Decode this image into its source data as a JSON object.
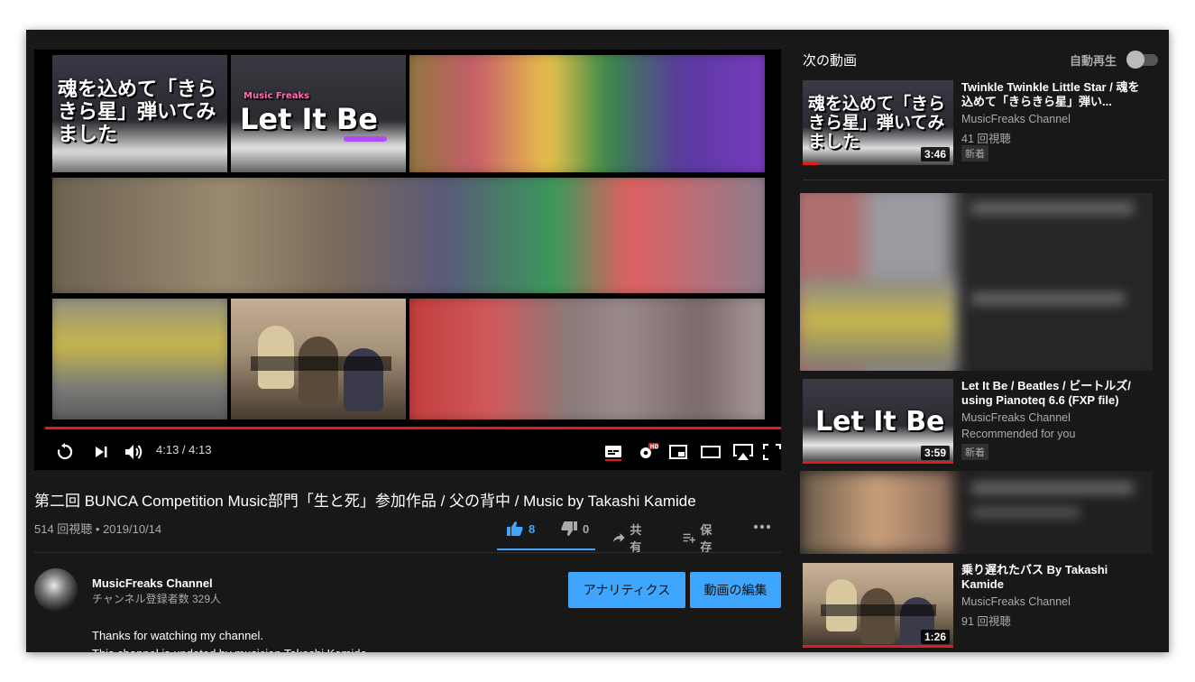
{
  "player": {
    "time": "4:13 / 4:13",
    "endscreen": {
      "tile1_text": "魂を込めて「きらきら星」弾いてみました",
      "tile2_text": "Let It Be",
      "tile2_sub": "Music Freaks"
    }
  },
  "video": {
    "title": "第二回 BUNCA Competition Music部門「生と死」参加作品 / 父の背中 / Music by Takashi Kamide",
    "meta": "514 回視聴 • 2019/10/14",
    "likes": "8",
    "dislikes": "0",
    "share_label": "共有",
    "save_label": "保存"
  },
  "channel": {
    "name": "MusicFreaks Channel",
    "subscribers": "チャンネル登録者数 329人",
    "analytics_button": "アナリティクス",
    "edit_button": "動画の編集",
    "description": "Thanks for watching my channel.",
    "description_line2": "This channel is updated by musician Takashi Kamide."
  },
  "sidebar": {
    "up_next": "次の動画",
    "autoplay": "自動再生",
    "items": [
      {
        "title": "Twinkle Twinkle Little Star / 魂を込めて「きらきら星」弾い...",
        "channel": "MusicFreaks Channel",
        "views": "41 回視聴",
        "badge": "新着",
        "duration": "3:46",
        "watched": 0.1
      },
      {
        "title": "Let It Be / Beatles / ビートルズ/ using Pianoteq 6.6 (FXP file)",
        "channel": "MusicFreaks Channel",
        "views": "Recommended for you",
        "badge": "新着",
        "duration": "3:59",
        "watched": 1.0
      },
      {
        "title": "乗り遅れたバス By Takashi Kamide",
        "channel": "MusicFreaks Channel",
        "views": "91 回視聴",
        "duration": "1:26",
        "watched": 1.0
      }
    ]
  },
  "colors": {
    "accent": "#3ea6ff",
    "progress": "#e21b1b",
    "background": "#181818"
  }
}
